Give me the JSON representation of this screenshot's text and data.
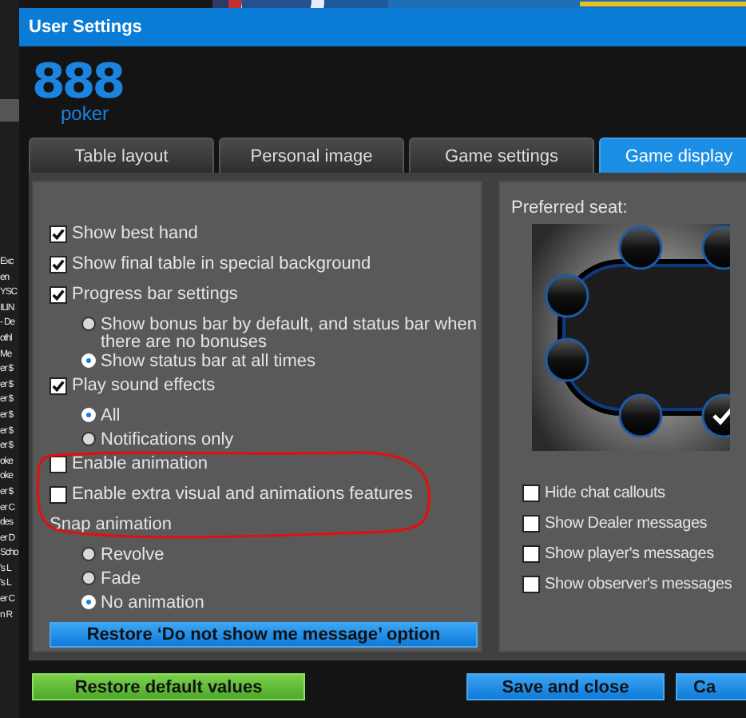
{
  "window": {
    "title": "User Settings"
  },
  "background_list": [
    "Exc",
    "en",
    "YSC",
    "ILIN",
    "- De",
    "othl",
    " Me",
    "er $",
    "er $",
    "er $",
    "er $",
    "er $",
    "er $",
    "oke",
    "oke",
    "er $",
    "er C",
    "des",
    "er D",
    "Scho",
    "'s L",
    "'s L",
    "er C",
    "n R"
  ],
  "logo": {
    "digits": "888",
    "word": "poker"
  },
  "tabs": [
    {
      "label": "Table layout",
      "selected": false
    },
    {
      "label": "Personal image",
      "selected": false
    },
    {
      "label": "Game settings",
      "selected": false
    },
    {
      "label": "Game display",
      "selected": true
    }
  ],
  "options": [
    {
      "kind": "checkbox",
      "label": "Show best hand",
      "checked": true
    },
    {
      "kind": "checkbox",
      "label": "Show final table in special background",
      "checked": true
    },
    {
      "kind": "checkbox",
      "label": "Progress bar settings",
      "checked": true
    },
    {
      "kind": "radio",
      "label": "Show bonus bar by default, and status bar when there are no bonuses",
      "selected": false
    },
    {
      "kind": "radio",
      "label": "Show status bar at all times",
      "selected": true
    },
    {
      "kind": "checkbox",
      "label": "Play sound effects",
      "checked": true
    },
    {
      "kind": "radio",
      "label": "All",
      "selected": true
    },
    {
      "kind": "radio",
      "label": "Notifications only",
      "selected": false
    },
    {
      "kind": "checkbox",
      "label": "Enable animation",
      "checked": false
    },
    {
      "kind": "checkbox",
      "label": "Enable extra visual and animations features",
      "checked": false
    },
    {
      "kind": "heading",
      "label": "Snap animation"
    },
    {
      "kind": "radio",
      "label": "Revolve",
      "selected": false
    },
    {
      "kind": "radio",
      "label": "Fade",
      "selected": false
    },
    {
      "kind": "radio",
      "label": "No animation",
      "selected": true
    }
  ],
  "restore_message_button": "Restore ‘Do not show me message’ option",
  "preferred_seat": {
    "label": "Preferred seat:",
    "seats": [
      {
        "selected": false
      },
      {
        "selected": false
      },
      {
        "selected": false
      },
      {
        "selected": false
      },
      {
        "selected": false
      },
      {
        "selected": true
      }
    ]
  },
  "chat_options": [
    {
      "label": "Hide chat callouts",
      "checked": false
    },
    {
      "label": "Show Dealer messages",
      "checked": false
    },
    {
      "label": "Show player's messages",
      "checked": false
    },
    {
      "label": "Show observer's messages",
      "checked": false
    }
  ],
  "buttons": [
    {
      "label": "Restore default values",
      "kind": "reset"
    },
    {
      "label": "Save and close",
      "kind": "primary"
    },
    {
      "label": "Ca",
      "kind": "primary"
    }
  ]
}
